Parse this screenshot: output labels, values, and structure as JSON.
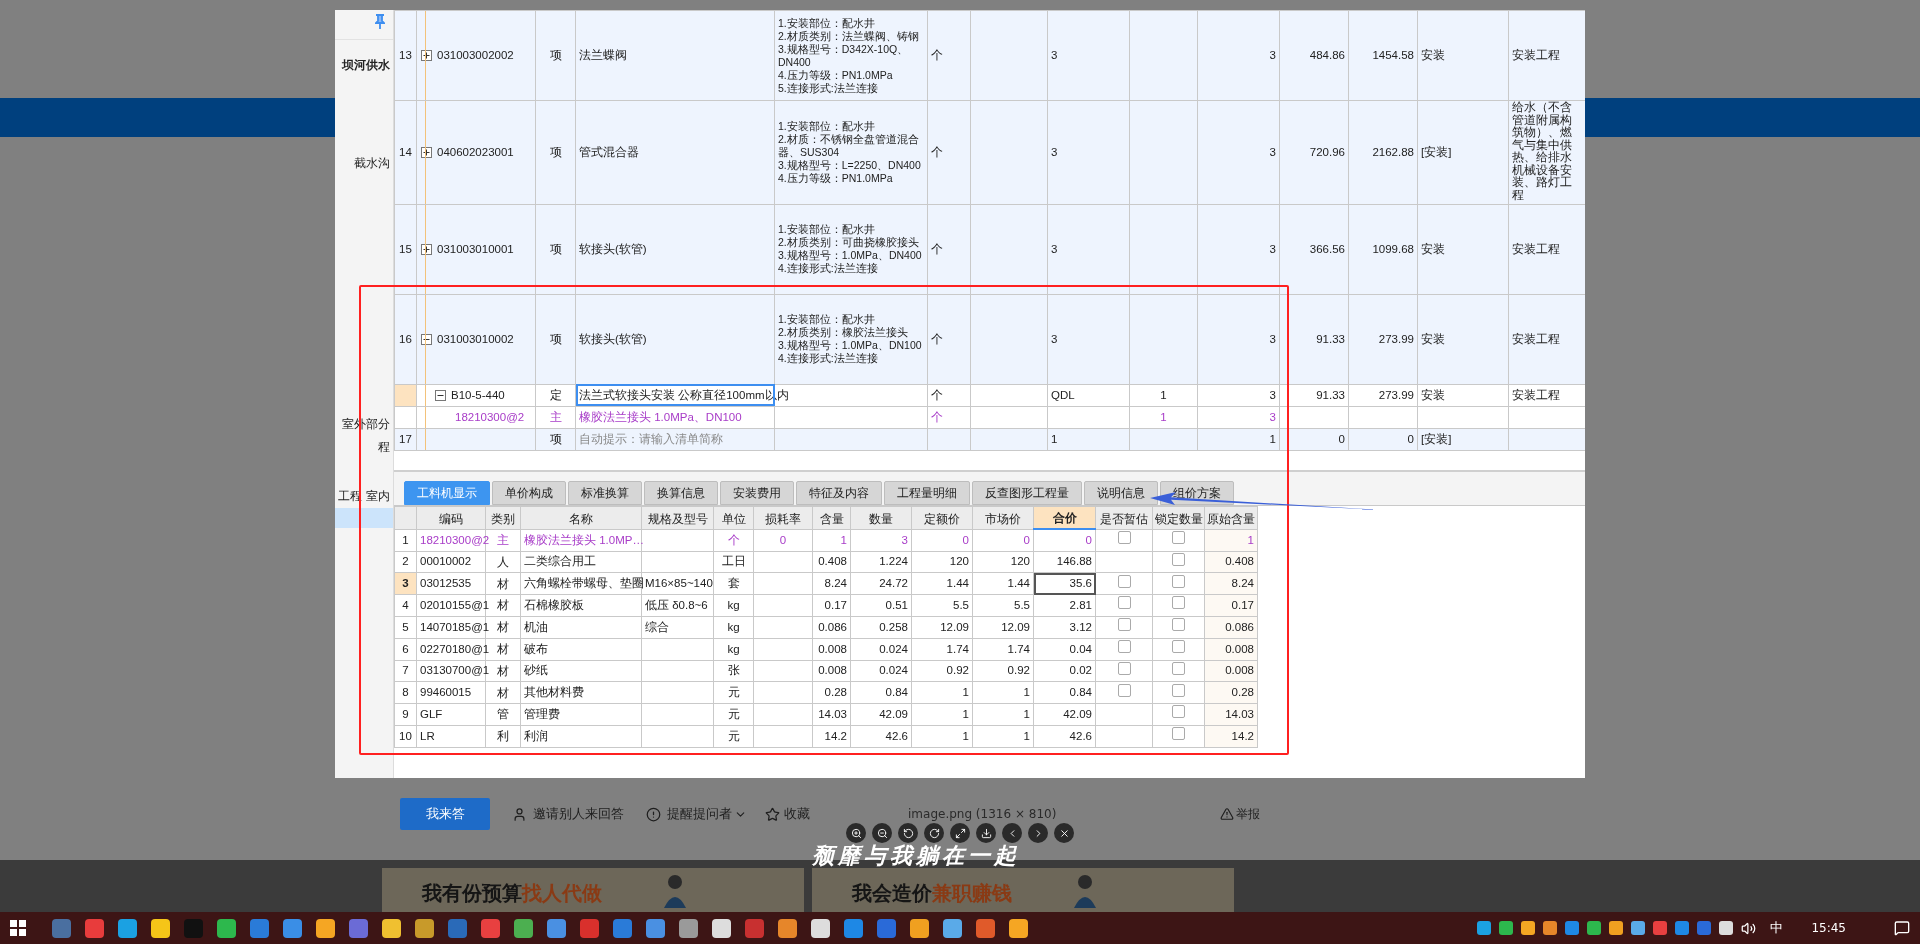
{
  "viewer": {
    "sidebar": {
      "items": [
        {
          "label": "坝河供水",
          "selected": false,
          "bold": true
        },
        {
          "label": "截水沟",
          "selected": false,
          "bold": false
        },
        {
          "label": "室外部分",
          "selected": false,
          "bold": false
        },
        {
          "label": "程",
          "selected": false,
          "bold": false
        },
        {
          "label": "工程 室内",
          "selected": false,
          "bold": false
        },
        {
          "selected": true,
          "bold": false
        }
      ]
    },
    "bill_table": {
      "rows": [
        {
          "number": "13",
          "kind": "item",
          "expanded": false,
          "selected": false,
          "code": "031003002002",
          "cells": [
            "项",
            "法兰蝶阀",
            [
              "1.安装部位：配水井",
              "2.材质类别：法兰蝶阀、铸钢",
              "3.规格型号：D342X-10Q、DN400",
              "4.压力等级：PN1.0MPa",
              "5.连接形式:法兰连接"
            ],
            "个",
            null,
            "3",
            null,
            "3",
            "484.86",
            "1454.58",
            "安装",
            "安装工程"
          ]
        },
        {
          "number": "14",
          "kind": "item",
          "expanded": false,
          "selected": false,
          "code": "040602023001",
          "cells": [
            "项",
            "管式混合器",
            [
              "1.安装部位：配水井",
              "2.材质：不锈钢全盘管道混合器、SUS304",
              "3.规格型号：L=2250、DN400",
              "4.压力等级：PN1.0MPa"
            ],
            "个",
            null,
            "3",
            null,
            "3",
            "720.96",
            "2162.88",
            "[安装]",
            "给水（不含管道附属构筑物）、燃气与集中供热、给排水机械设备安装、路灯工程"
          ]
        },
        {
          "number": "15",
          "kind": "item",
          "expanded": false,
          "selected": false,
          "code": "031003010001",
          "cells": [
            "项",
            "软接头(软管)",
            [
              "1.安装部位：配水井",
              "2.材质类别：可曲挠橡胶接头",
              "3.规格型号：1.0MPa、DN400",
              "4.连接形式:法兰连接"
            ],
            "个",
            null,
            "3",
            null,
            "3",
            "366.56",
            "1099.68",
            "安装",
            "安装工程"
          ]
        },
        {
          "number": "16",
          "kind": "item",
          "expanded": true,
          "selected": false,
          "code": "031003010002",
          "cells": [
            "项",
            "软接头(软管)",
            [
              "1.安装部位：配水井",
              "2.材质类别：橡胶法兰接头",
              "3.规格型号：1.0MPa、DN100",
              "4.连接形式:法兰连接"
            ],
            "个",
            null,
            "3",
            null,
            "3",
            "91.33",
            "273.99",
            "安装",
            "安装工程"
          ],
          "children": [
            {
              "kind": "quota",
              "expanded": true,
              "selected": true,
              "code": "B10-5-440",
              "cells": [
                "定",
                "法兰式软接头安装 公称直径100mm以内",
                null,
                "个",
                null,
                "QDL",
                "1",
                "3",
                "91.33",
                "273.99",
                "安装",
                "安装工程"
              ],
              "children": [
                {
                  "kind": "main",
                  "selected": false,
                  "code": "18210300@2",
                  "cells": [
                    "主",
                    "橡胶法兰接头 1.0MPa、DN100",
                    null,
                    "个",
                    null,
                    null,
                    "1",
                    "3",
                    null,
                    null,
                    null,
                    null
                  ]
                }
              ]
            }
          ]
        },
        {
          "number": "17",
          "kind": "new",
          "selected": false,
          "cells": [
            "项",
            "自动提示：请输入清单简称",
            null,
            null,
            null,
            "1",
            null,
            "1",
            "0",
            "0",
            "[安装]",
            null
          ]
        }
      ]
    },
    "tabs": [
      {
        "label": "工料机显示",
        "selected": true
      },
      {
        "label": "单价构成",
        "selected": false
      },
      {
        "label": "标准换算",
        "selected": false
      },
      {
        "label": "换算信息",
        "selected": false
      },
      {
        "label": "安装费用",
        "selected": false
      },
      {
        "label": "特征及内容",
        "selected": false
      },
      {
        "label": "工程量明细",
        "selected": false
      },
      {
        "label": "反查图形工程量",
        "selected": false
      },
      {
        "label": "说明信息",
        "selected": false
      },
      {
        "label": "组价方案",
        "selected": false
      }
    ],
    "resource_table": {
      "columns": [
        {
          "label": "编码",
          "selected": false
        },
        {
          "label": "类别",
          "selected": false
        },
        {
          "label": "名称",
          "selected": false
        },
        {
          "label": "规格及型号",
          "selected": false
        },
        {
          "label": "单位",
          "selected": false
        },
        {
          "label": "损耗率",
          "selected": false
        },
        {
          "label": "含量",
          "selected": false
        },
        {
          "label": "数量",
          "selected": false
        },
        {
          "label": "定额价",
          "selected": false
        },
        {
          "label": "市场价",
          "selected": false
        },
        {
          "label": "合价",
          "selected": true
        },
        {
          "label": "是否暂估",
          "selected": false
        },
        {
          "label": "锁定数量",
          "selected": false
        },
        {
          "label": "原始含量",
          "selected": false
        }
      ],
      "rows": [
        {
          "number": "1",
          "kind": "main",
          "selected": false,
          "cells": [
            "18210300@2",
            "主",
            "橡胶法兰接头 1.0MP…",
            null,
            "个",
            "0",
            "1",
            "3",
            "0",
            "0",
            "0"
          ],
          "estimate_checked": false,
          "lock_checked": false,
          "original": "1"
        },
        {
          "number": "2",
          "kind": "normal",
          "selected": false,
          "cells": [
            "00010002",
            "人",
            "二类综合用工",
            null,
            "工日",
            null,
            "0.408",
            "1.224",
            "120",
            "120",
            "146.88"
          ],
          "lock_checked": false,
          "original": "0.408"
        },
        {
          "number": "3",
          "kind": "normal",
          "selected": true,
          "cells": [
            "03012535",
            "材",
            "六角螺栓带螺母、垫圈",
            "M16×85~140",
            "套",
            null,
            "8.24",
            "24.72",
            "1.44",
            "1.44",
            "35.6"
          ],
          "estimate_checked": false,
          "lock_checked": false,
          "original": "8.24"
        },
        {
          "number": "4",
          "kind": "normal",
          "selected": false,
          "cells": [
            "02010155@1",
            "材",
            "石棉橡胶板",
            "低压 δ0.8~6",
            "kg",
            null,
            "0.17",
            "0.51",
            "5.5",
            "5.5",
            "2.81"
          ],
          "estimate_checked": false,
          "lock_checked": false,
          "original": "0.17"
        },
        {
          "number": "5",
          "kind": "normal",
          "selected": false,
          "cells": [
            "14070185@1",
            "材",
            "机油",
            "综合",
            "kg",
            null,
            "0.086",
            "0.258",
            "12.09",
            "12.09",
            "3.12"
          ],
          "estimate_checked": false,
          "lock_checked": false,
          "original": "0.086"
        },
        {
          "number": "6",
          "kind": "normal",
          "selected": false,
          "cells": [
            "02270180@1",
            "材",
            "破布",
            null,
            "kg",
            null,
            "0.008",
            "0.024",
            "1.74",
            "1.74",
            "0.04"
          ],
          "estimate_checked": false,
          "lock_checked": false,
          "original": "0.008"
        },
        {
          "number": "7",
          "kind": "normal",
          "selected": false,
          "cells": [
            "03130700@1",
            "材",
            "砂纸",
            null,
            "张",
            null,
            "0.008",
            "0.024",
            "0.92",
            "0.92",
            "0.02"
          ],
          "estimate_checked": false,
          "lock_checked": false,
          "original": "0.008"
        },
        {
          "number": "8",
          "kind": "normal",
          "selected": false,
          "cells": [
            "99460015",
            "材",
            "其他材料费",
            null,
            "元",
            null,
            "0.28",
            "0.84",
            "1",
            "1",
            "0.84"
          ],
          "estimate_checked": false,
          "lock_checked": false,
          "original": "0.28"
        },
        {
          "number": "9",
          "kind": "normal",
          "selected": false,
          "cells": [
            "GLF",
            "管",
            "管理费",
            null,
            "元",
            null,
            "14.03",
            "42.09",
            "1",
            "1",
            "42.09"
          ],
          "lock_checked": false,
          "original": "14.03"
        },
        {
          "number": "10",
          "kind": "normal",
          "selected": false,
          "cells": [
            "LR",
            "利",
            "利润",
            null,
            "元",
            null,
            "14.2",
            "42.6",
            "1",
            "1",
            "42.6"
          ],
          "lock_checked": false,
          "original": "14.2"
        }
      ]
    }
  },
  "answer_bar": {
    "answer_button": "我来答",
    "invite": "邀请别人来回答",
    "remind": "提醒提问者",
    "favorite": "收藏",
    "report": "举报"
  },
  "caption": "image.png (1316 × 810)",
  "subtitle": "颓靡与我躺在一起",
  "promos": [
    {
      "text": "我有份预算",
      "highlight": "找人代做"
    },
    {
      "text": "我会造价",
      "highlight": "兼职赚钱"
    }
  ],
  "taskbar": {
    "ime": "中",
    "time": "15:45"
  }
}
